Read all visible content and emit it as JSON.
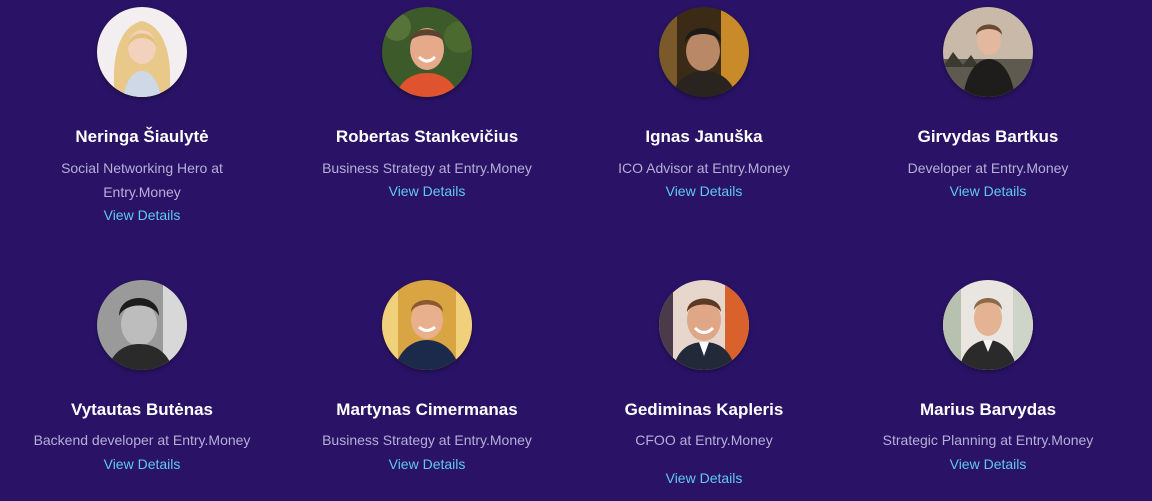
{
  "accent_color": "#5fc9f0",
  "background_color": "#2a1366",
  "members": [
    {
      "name": "Neringa Šiaulytė",
      "role": "Social Networking Hero at Entry.Money",
      "link": "View Details",
      "photo": "woman-blonde-avatar"
    },
    {
      "name": "Robertas Stankevičius",
      "role": "Business Strategy at Entry.Money",
      "link": "View Details",
      "photo": "man-bald-avatar"
    },
    {
      "name": "Ignas Januška",
      "role": "ICO Advisor at Entry.Money",
      "link": "View Details",
      "photo": "man-dark-avatar"
    },
    {
      "name": "Girvydas Bartkus",
      "role": "Developer at Entry.Money",
      "link": "View Details",
      "photo": "man-outdoor-avatar"
    },
    {
      "name": "Vytautas Butėnas",
      "role": "Backend developer at Entry.Money",
      "link": "View Details",
      "photo": "man-bw-avatar"
    },
    {
      "name": "Martynas Cimermanas",
      "role": "Business Strategy at Entry.Money",
      "link": "View Details",
      "photo": "man-smiling-avatar"
    },
    {
      "name": "Gediminas Kapleris",
      "role": "CFOO at Entry.Money",
      "link": "View Details",
      "photo": "man-suit-avatar"
    },
    {
      "name": "Marius Barvydas",
      "role": "Strategic Planning at Entry.Money",
      "link": "View Details",
      "photo": "man-vest-avatar"
    }
  ]
}
